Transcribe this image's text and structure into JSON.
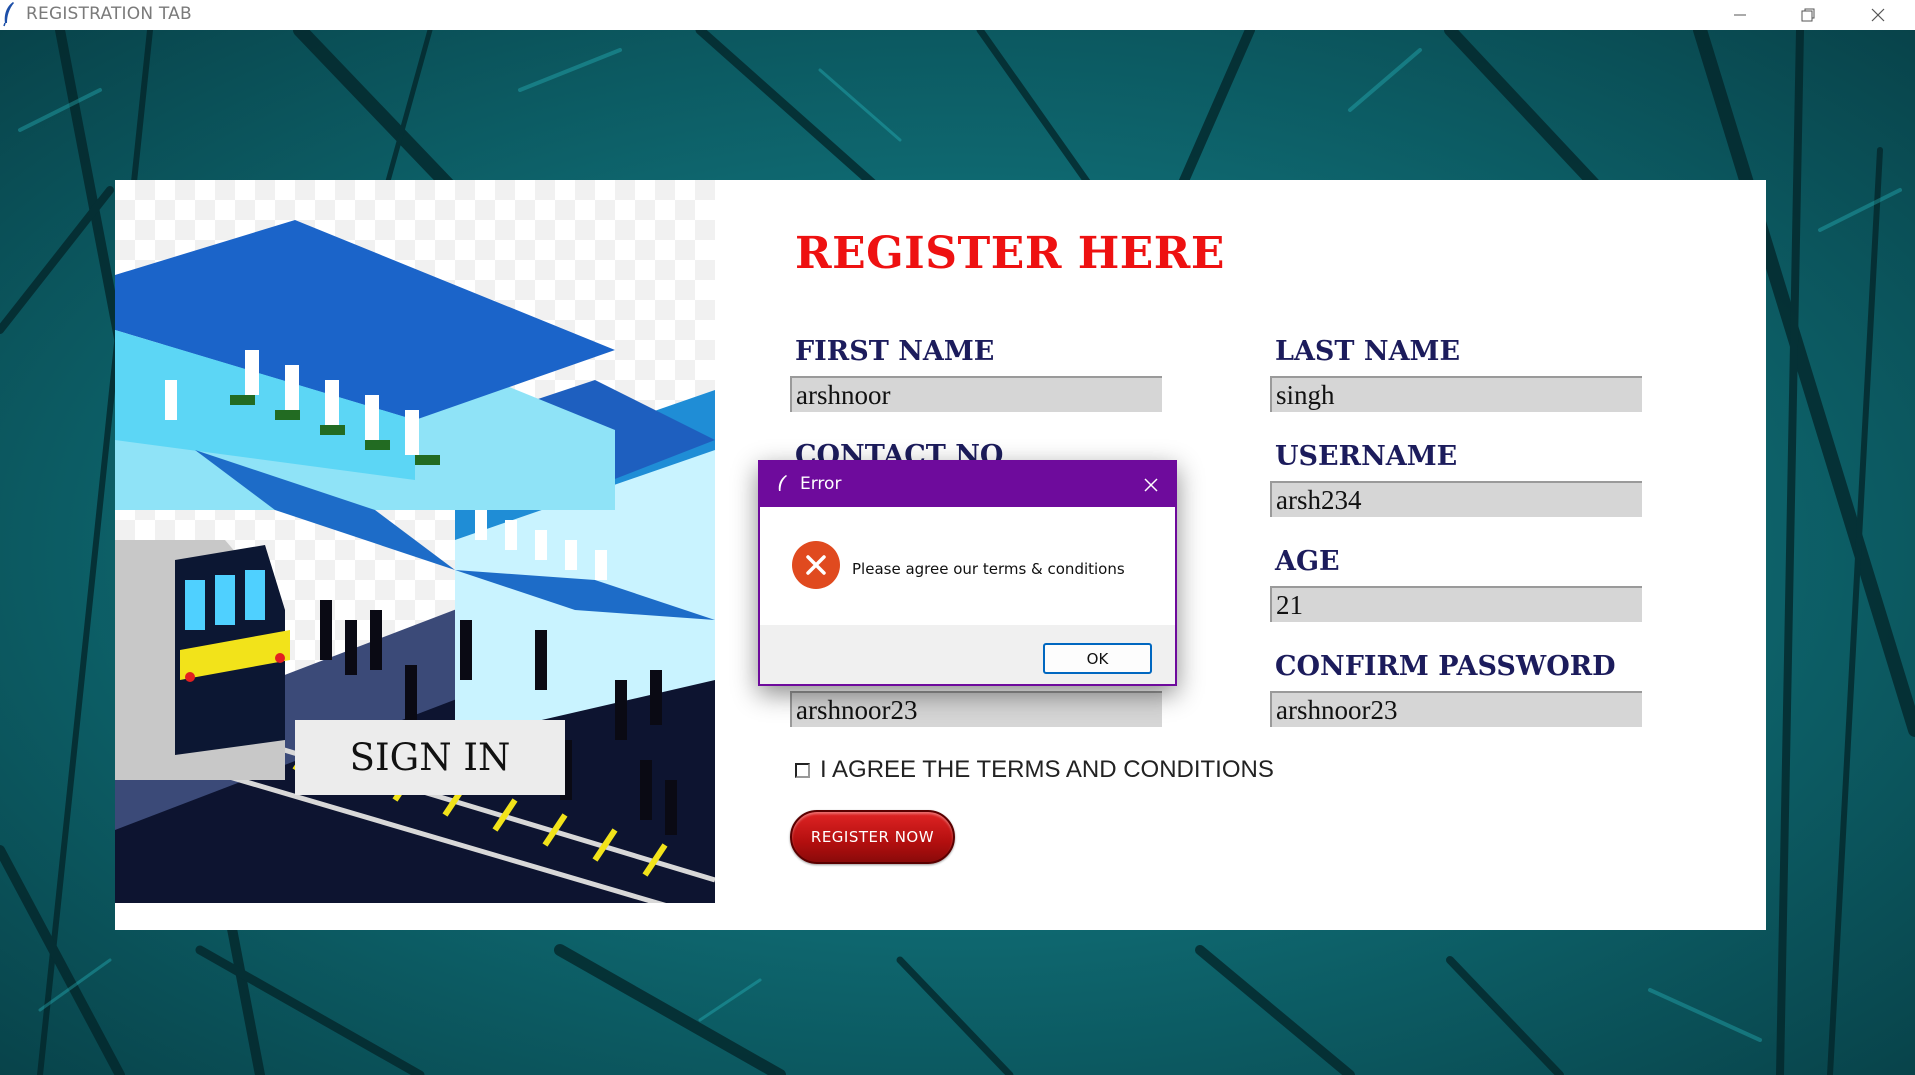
{
  "window": {
    "title": "REGISTRATION TAB",
    "controls": {
      "minimize": "minimize-icon",
      "maximize": "restore-icon",
      "close": "close-icon"
    }
  },
  "illustration": {
    "description_icon": "railway-station-illustration",
    "sign_in_label": "SIGN IN"
  },
  "form": {
    "heading": "REGISTER HERE",
    "first_name": {
      "label": "FIRST NAME",
      "value": "arshnoor"
    },
    "last_name": {
      "label": "LAST NAME",
      "value": "singh"
    },
    "contact_no": {
      "label": "CONTACT NO",
      "value": ""
    },
    "username": {
      "label": "USERNAME",
      "value": "arsh234"
    },
    "age": {
      "label": "AGE",
      "value": "21"
    },
    "password": {
      "label": "",
      "value": "arshnoor23"
    },
    "confirm_password": {
      "label": "CONFIRM PASSWORD",
      "value": "arshnoor23"
    },
    "terms_label": "I AGREE THE TERMS AND CONDITIONS",
    "terms_checked": false,
    "register_label": "REGISTER NOW"
  },
  "dialog": {
    "title": "Error",
    "message": "Please agree our terms & conditions",
    "ok_label": "OK",
    "icon": "error-icon"
  },
  "colors": {
    "heading": "#ee1111",
    "label": "#1c1c5c",
    "dialog_titlebar": "#6e0b9c",
    "register_button": "#c41414",
    "background": "#0f6c74"
  }
}
